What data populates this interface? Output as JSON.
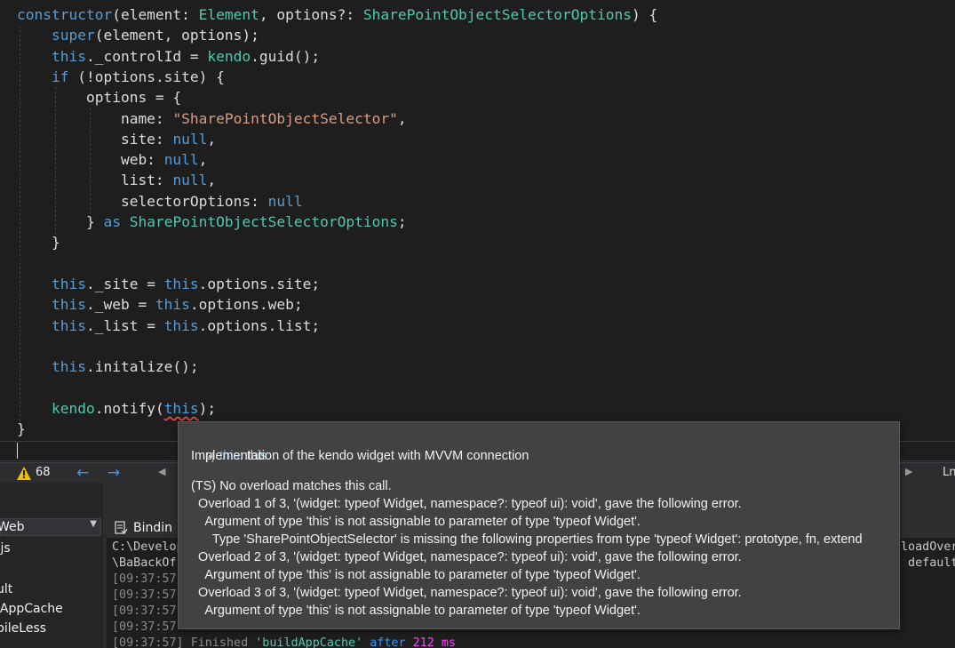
{
  "editor": {
    "code_lines": [
      [
        {
          "t": "constructor",
          "c": "kw"
        },
        {
          "t": "(element: ",
          "c": "pn"
        },
        {
          "t": "Element",
          "c": "ty"
        },
        {
          "t": ", options?: ",
          "c": "pn"
        },
        {
          "t": "SharePointObjectSelectorOptions",
          "c": "ty"
        },
        {
          "t": ") {",
          "c": "pn"
        }
      ],
      [
        {
          "t": "    ",
          "c": "pn"
        },
        {
          "t": "super",
          "c": "kw"
        },
        {
          "t": "(element, options);",
          "c": "pn"
        }
      ],
      [
        {
          "t": "    ",
          "c": "pn"
        },
        {
          "t": "this",
          "c": "kw"
        },
        {
          "t": "._controlId = ",
          "c": "pn"
        },
        {
          "t": "kendo",
          "c": "ty"
        },
        {
          "t": ".guid();",
          "c": "pn"
        }
      ],
      [
        {
          "t": "    ",
          "c": "pn"
        },
        {
          "t": "if",
          "c": "kw"
        },
        {
          "t": " (!options.site) {",
          "c": "pn"
        }
      ],
      [
        {
          "t": "        options = {",
          "c": "pn"
        }
      ],
      [
        {
          "t": "            name: ",
          "c": "pn"
        },
        {
          "t": "\"SharePointObjectSelector\"",
          "c": "st"
        },
        {
          "t": ",",
          "c": "pn"
        }
      ],
      [
        {
          "t": "            site: ",
          "c": "pn"
        },
        {
          "t": "null",
          "c": "kw"
        },
        {
          "t": ",",
          "c": "pn"
        }
      ],
      [
        {
          "t": "            web: ",
          "c": "pn"
        },
        {
          "t": "null",
          "c": "kw"
        },
        {
          "t": ",",
          "c": "pn"
        }
      ],
      [
        {
          "t": "            list: ",
          "c": "pn"
        },
        {
          "t": "null",
          "c": "kw"
        },
        {
          "t": ",",
          "c": "pn"
        }
      ],
      [
        {
          "t": "            selectorOptions: ",
          "c": "pn"
        },
        {
          "t": "null",
          "c": "kw"
        }
      ],
      [
        {
          "t": "        } ",
          "c": "pn"
        },
        {
          "t": "as",
          "c": "kw"
        },
        {
          "t": " ",
          "c": "pn"
        },
        {
          "t": "SharePointObjectSelectorOptions",
          "c": "ty"
        },
        {
          "t": ";",
          "c": "pn"
        }
      ],
      [
        {
          "t": "    }",
          "c": "pn"
        }
      ],
      [],
      [
        {
          "t": "    ",
          "c": "pn"
        },
        {
          "t": "this",
          "c": "kw"
        },
        {
          "t": "._site = ",
          "c": "pn"
        },
        {
          "t": "this",
          "c": "kw"
        },
        {
          "t": ".options.site;",
          "c": "pn"
        }
      ],
      [
        {
          "t": "    ",
          "c": "pn"
        },
        {
          "t": "this",
          "c": "kw"
        },
        {
          "t": "._web = ",
          "c": "pn"
        },
        {
          "t": "this",
          "c": "kw"
        },
        {
          "t": ".options.web;",
          "c": "pn"
        }
      ],
      [
        {
          "t": "    ",
          "c": "pn"
        },
        {
          "t": "this",
          "c": "kw"
        },
        {
          "t": "._list = ",
          "c": "pn"
        },
        {
          "t": "this",
          "c": "kw"
        },
        {
          "t": ".options.list;",
          "c": "pn"
        }
      ],
      [],
      [
        {
          "t": "    ",
          "c": "pn"
        },
        {
          "t": "this",
          "c": "kw"
        },
        {
          "t": ".initalize();",
          "c": "pn"
        }
      ],
      [],
      [
        {
          "t": "    ",
          "c": "pn"
        },
        {
          "t": "kendo",
          "c": "ty"
        },
        {
          "t": ".notify(",
          "c": "pn"
        },
        {
          "t": "this",
          "c": "kw squig"
        },
        {
          "t": ");",
          "c": "pn"
        }
      ],
      [
        {
          "t": "}",
          "c": "pn"
        }
      ]
    ]
  },
  "editor_status": {
    "warning_count": "68",
    "back_icon": "arrow-left-icon",
    "forward_icon": "arrow-right-icon",
    "line_indicator": "Ln"
  },
  "left_panel": {
    "project_dropdown": "Web",
    "items": [
      ".js",
      "ult",
      "lAppCache",
      "pileLess"
    ]
  },
  "output": {
    "tab_label": "Bindin",
    "lines": [
      [
        {
          "t": "C:\\Develop",
          "c": ""
        }
      ],
      [
        {
          "t": "\\BaBackOf",
          "c": ""
        }
      ],
      [
        {
          "t": "[09:37:57",
          "c": "ts"
        }
      ],
      [
        {
          "t": "[09:37:57",
          "c": "ts"
        }
      ],
      [
        {
          "t": "[09:37:57",
          "c": "ts"
        }
      ],
      [
        {
          "t": "[09:37:57",
          "c": "ts"
        }
      ],
      [
        {
          "t": "[09:37:57] ",
          "c": "ts"
        },
        {
          "t": "Finished ",
          "c": "ts"
        },
        {
          "t": "'buildAppCache'",
          "c": "hl"
        },
        {
          "t": " after ",
          "c": "bl"
        },
        {
          "t": "212 ms",
          "c": "mg"
        }
      ]
    ],
    "right_fragments": [
      "loadOver",
      " default"
    ]
  },
  "tooltip": {
    "icon": "widget-icon",
    "icon_glyph": "[•]",
    "signature": "this",
    "signature_rest": ": this",
    "description": "Implementation of the kendo widget with MVVM connection",
    "error_lines": [
      "(TS) No overload matches this call.",
      "  Overload 1 of 3, '(widget: typeof Widget, namespace?: typeof ui): void', gave the following error.",
      "    Argument of type 'this' is not assignable to parameter of type 'typeof Widget'.",
      "      Type 'SharePointObjectSelector' is missing the following properties from type 'typeof Widget': prototype, fn, extend",
      "  Overload 2 of 3, '(widget: typeof Widget, namespace?: typeof ui): void', gave the following error.",
      "    Argument of type 'this' is not assignable to parameter of type 'typeof Widget'.",
      "  Overload 3 of 3, '(widget: typeof Widget, namespace?: typeof ui): void', gave the following error.",
      "    Argument of type 'this' is not assignable to parameter of type 'typeof Widget'."
    ]
  },
  "colors": {
    "keyword": "#569cd6",
    "type": "#4ec9b0",
    "string": "#d69d85",
    "error": "#f14c4c"
  }
}
